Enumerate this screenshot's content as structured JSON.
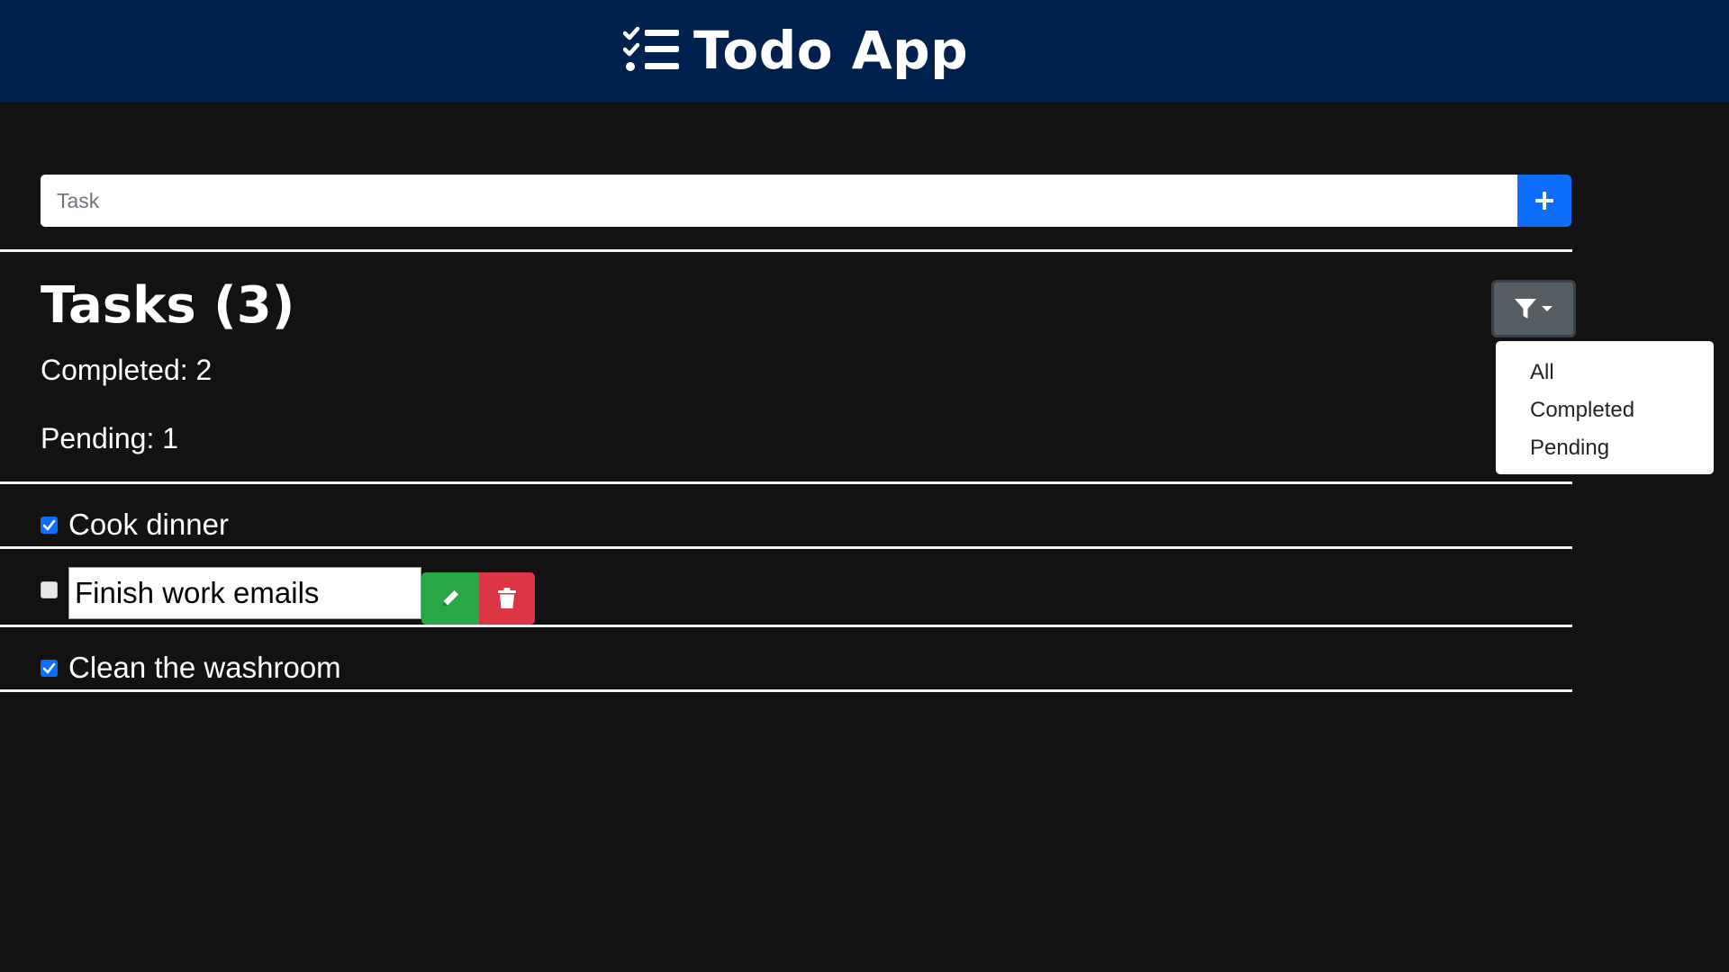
{
  "header": {
    "title": "Todo App",
    "icon": "list-check-icon"
  },
  "new_task": {
    "placeholder": "Task",
    "value": "",
    "add_icon": "plus-icon"
  },
  "tasks_panel": {
    "heading": "Tasks (3)",
    "completed_text": "Completed: 2",
    "pending_text": "Pending: 1"
  },
  "filter": {
    "button_icon": "filter-icon",
    "options": [
      "All",
      "Completed",
      "Pending"
    ]
  },
  "tasks": [
    {
      "label": "Cook dinner",
      "completed": true,
      "editing": false
    },
    {
      "label": "Finish work emails",
      "completed": false,
      "editing": true,
      "actions": [
        "pencil-icon",
        "trash-icon"
      ]
    },
    {
      "label": "Clean the washroom",
      "completed": true,
      "editing": false
    }
  ],
  "colors": {
    "navbar": "#00214d",
    "background": "#121212",
    "primary": "#0d6efd",
    "success": "#28a745",
    "danger": "#dc3545",
    "secondary": "#565e64"
  }
}
